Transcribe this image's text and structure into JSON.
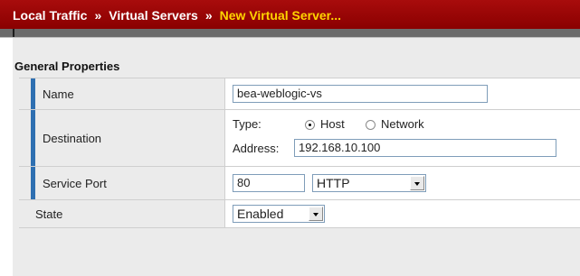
{
  "breadcrumb": {
    "items": [
      "Local Traffic",
      "Virtual Servers"
    ],
    "separator": "»",
    "current": "New Virtual Server..."
  },
  "section": {
    "title": "General Properties"
  },
  "fields": {
    "name": {
      "label": "Name",
      "value": "bea-weblogic-vs"
    },
    "destination": {
      "label": "Destination",
      "type_label": "Type:",
      "type_options": [
        "Host",
        "Network"
      ],
      "type_selected": "Host",
      "address_label": "Address:",
      "address_value": "192.168.10.100"
    },
    "service_port": {
      "label": "Service Port",
      "port_value": "80",
      "protocol_value": "HTTP"
    },
    "state": {
      "label": "State",
      "value": "Enabled"
    }
  },
  "colors": {
    "header_red": "#a80c0c",
    "current_crumb": "#ffd400",
    "required_marker": "#2e6fb1"
  }
}
